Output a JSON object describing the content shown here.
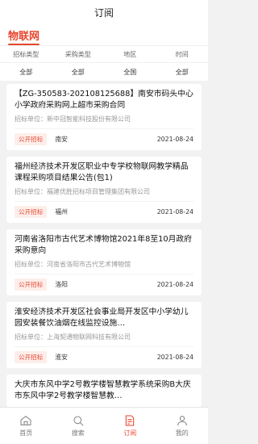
{
  "header": {
    "title": "订阅"
  },
  "site": {
    "title": "物联网"
  },
  "filters": {
    "labels": [
      "招标类型",
      "采购类型",
      "地区",
      "时间"
    ],
    "values": [
      "全部",
      "全部",
      "全国",
      "全部"
    ]
  },
  "cards": [
    {
      "title": "【ZG-350583-202108125688】南安市码头中心小学政府采购网上超市采购合同",
      "org": "招标单位：新中冠智能科技股份有限公司",
      "tag": "公开招标",
      "location": "南安",
      "date": "2021-08-24"
    },
    {
      "title": "福州经济技术开发区职业中专学校物联网教学精品课程采购项目结果公告(包1)",
      "org": "招标单位：福建优胜招标项目管理集团有限公司",
      "tag": "公开招标",
      "location": "福州",
      "date": "2021-08-24"
    },
    {
      "title": "河南省洛阳市古代艺术博物馆2021年8至10月政府采购意向",
      "org": "招标单位：河南省洛阳市古代艺术博物馆",
      "tag": "公开招标",
      "location": "洛阳",
      "date": "2021-08-24"
    },
    {
      "title": "淮安经济技术开发区社会事业局开发区中小学幼儿园安装餐饮油烟在线监控设施…",
      "org": "招标单位：上海契通物联网科技有限公司",
      "tag": "公开招标",
      "location": "淮安",
      "date": "2021-08-24"
    },
    {
      "title": "大庆市东风中学2号教学楼智慧教学系统采购B大庆市东风中学2号教学楼智慧教…",
      "org": "",
      "tag": "",
      "location": "",
      "date": ""
    }
  ],
  "tabs": [
    {
      "label": "首页",
      "icon": "home-icon"
    },
    {
      "label": "搜索",
      "icon": "search-icon"
    },
    {
      "label": "订阅",
      "icon": "subscribe-icon",
      "active": true
    },
    {
      "label": "我的",
      "icon": "profile-icon"
    }
  ],
  "colors": {
    "accent": "#e8462f"
  }
}
